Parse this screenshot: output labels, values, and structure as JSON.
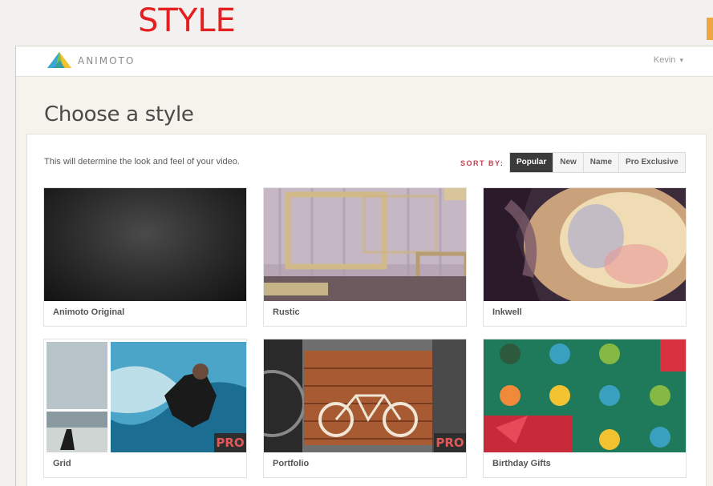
{
  "slide": {
    "title": "STYLE",
    "title_color": "#e41f1f"
  },
  "app": {
    "logo_text": "ANIMOTO",
    "user_name": "Kevin"
  },
  "page": {
    "title": "Choose a style",
    "subtitle": "This will determine the look and feel of your video."
  },
  "sort": {
    "label": "SORT BY:",
    "options": [
      "Popular",
      "New",
      "Name",
      "Pro Exclusive"
    ],
    "active": "Popular"
  },
  "styles": [
    {
      "name": "Animoto Original",
      "pro": false
    },
    {
      "name": "Rustic",
      "pro": false
    },
    {
      "name": "Inkwell",
      "pro": false
    },
    {
      "name": "Grid",
      "pro": true,
      "badge": "PRO"
    },
    {
      "name": "Portfolio",
      "pro": true,
      "badge": "PRO"
    },
    {
      "name": "Birthday Gifts",
      "pro": false
    }
  ],
  "colors": {
    "accent": "#c4404f",
    "active_sort": "#3b3b3b",
    "pro_badge_text": "#e35757"
  }
}
